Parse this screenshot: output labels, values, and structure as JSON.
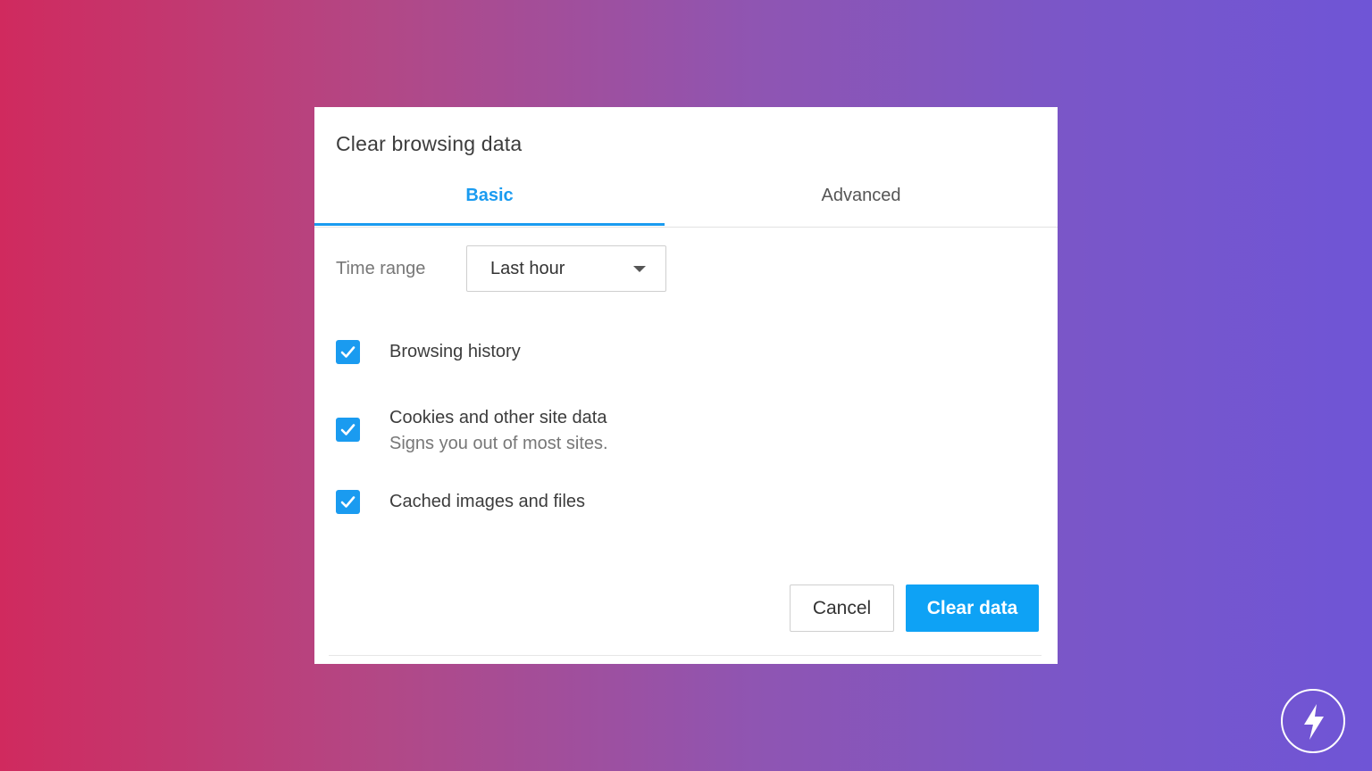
{
  "dialog": {
    "title": "Clear browsing data",
    "tabs": [
      {
        "label": "Basic",
        "active": true
      },
      {
        "label": "Advanced",
        "active": false
      }
    ],
    "time_range": {
      "label": "Time range",
      "selected": "Last hour"
    },
    "options": [
      {
        "label": "Browsing history",
        "sub": "",
        "checked": true
      },
      {
        "label": "Cookies and other site data",
        "sub": "Signs you out of most sites.",
        "checked": true
      },
      {
        "label": "Cached images and files",
        "sub": "",
        "checked": true
      }
    ],
    "buttons": {
      "cancel_label": "Cancel",
      "clear_label": "Clear data"
    }
  },
  "colors": {
    "accent": "#1a9bf0",
    "primary_button": "#0ea2f5",
    "gradient_left": "#d02a5e",
    "gradient_right": "#6f55d6"
  },
  "icons": {
    "badge": "lightning-bolt-icon",
    "dropdown": "chevron-down-icon",
    "checkbox": "checkmark-icon"
  }
}
